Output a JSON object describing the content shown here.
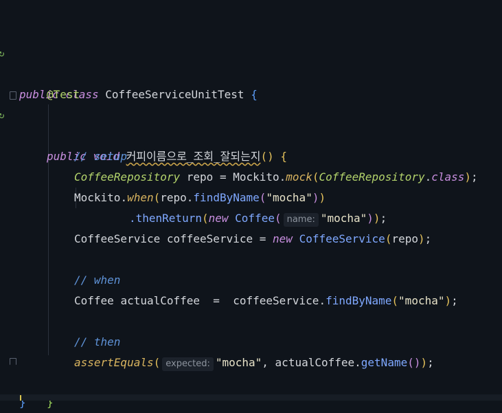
{
  "gutter": {
    "run_marker": "↻"
  },
  "code": {
    "class_kw1": "public",
    "class_kw2": "class",
    "class_name": "CoffeeServiceUnitTest",
    "annotation": "@Test",
    "method_kw1": "public",
    "method_kw2": "void",
    "method_name": "커피이름으로_조회_잘되는지",
    "comment_setup": "// setup",
    "repo_type": "CoffeeRepository",
    "repo_var": "repo",
    "mockito": "Mockito",
    "mock_fn": "mock",
    "class_lit": "class",
    "when_fn": "when",
    "find_by_name": "findByName",
    "str_mocha": "\"mocha\"",
    "then_return": ".thenReturn",
    "new_kw": "new",
    "coffee_type": "Coffee",
    "hint_name": "name:",
    "service_type": "CoffeeService",
    "service_var": "coffeeService",
    "comment_when": "// when",
    "actual_var": "actualCoffee",
    "comment_then": "// then",
    "assert_fn": "assertEquals",
    "hint_expected": "expected:",
    "get_name": "getName"
  }
}
